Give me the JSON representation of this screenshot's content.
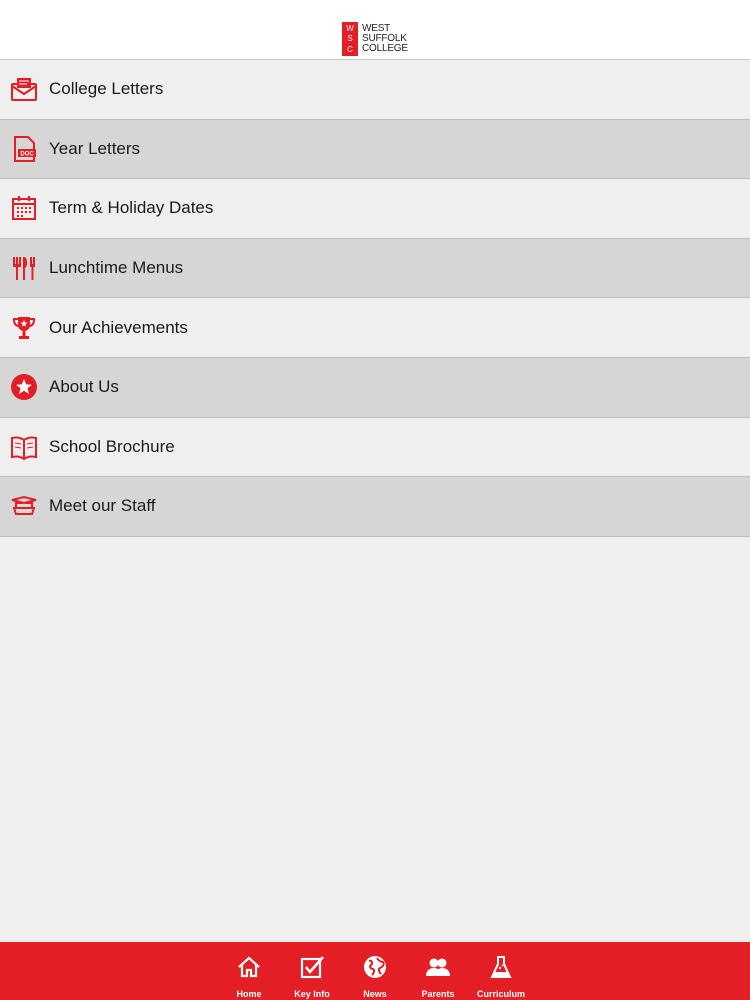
{
  "header": {
    "logo_letters": [
      "W",
      "S",
      "C"
    ],
    "logo_lines": [
      "WEST",
      "SUFFOLK",
      "COLLEGE"
    ]
  },
  "menu": {
    "items": [
      {
        "label": "College Letters",
        "icon": "envelope-icon"
      },
      {
        "label": "Year Letters",
        "icon": "doc-icon"
      },
      {
        "label": "Term & Holiday Dates",
        "icon": "calendar-icon"
      },
      {
        "label": "Lunchtime Menus",
        "icon": "cutlery-icon"
      },
      {
        "label": "Our Achievements",
        "icon": "trophy-icon"
      },
      {
        "label": "About Us",
        "icon": "star-icon"
      },
      {
        "label": "School Brochure",
        "icon": "book-icon"
      },
      {
        "label": "Meet our Staff",
        "icon": "staff-icon"
      }
    ]
  },
  "tabbar": {
    "tabs": [
      {
        "label": "Home",
        "icon": "home-icon"
      },
      {
        "label": "Key Info",
        "icon": "checkbox-icon"
      },
      {
        "label": "News",
        "icon": "globe-icon"
      },
      {
        "label": "Parents",
        "icon": "people-icon"
      },
      {
        "label": "Curriculum",
        "icon": "flask-icon"
      }
    ]
  },
  "colors": {
    "brand_red": "#e31e24",
    "row_light": "#efefef",
    "row_dark": "#d6d6d6"
  }
}
